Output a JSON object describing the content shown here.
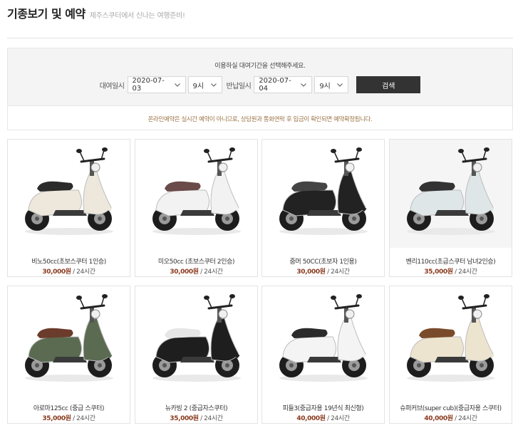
{
  "header": {
    "title": "기종보기 및 예약",
    "subtitle": "제주스쿠터에서 신나는 여행준비!"
  },
  "search": {
    "guide": "이용하실 대여기간을 선택해주세요.",
    "rent_label": "대여일시",
    "rent_date": "2020-07-03",
    "rent_hour": "9시",
    "return_label": "반납일시",
    "return_date": "2020-07-04",
    "return_hour": "9시",
    "search_button": "검색",
    "notice": "온라인예약은 실시간 예약이 아니므로, 상담원과 통화연락 후 입금이 확인되면 예약확정됩니다."
  },
  "products": [
    {
      "name": "비노50cc(초보스쿠터 1인승)",
      "price": "30,000원",
      "unit": " / 24시간",
      "body": "#ede7dc",
      "accent": "#2b2b2b"
    },
    {
      "name": "미오50cc (초보스쿠터 2인승)",
      "price": "30,000원",
      "unit": " / 24시간",
      "body": "#f2f2f2",
      "accent": "#6b4a4a"
    },
    {
      "name": "줌머 50CC(초보자 1인용)",
      "price": "30,000원",
      "unit": " / 24시간",
      "body": "#222222",
      "accent": "#444444"
    },
    {
      "name": "벤리110cc(초급스쿠터 남녀2인승)",
      "price": "35,000원",
      "unit": " / 24시간",
      "body": "#dfe6e8",
      "accent": "#333333"
    },
    {
      "name": "아로마125cc (중급 스쿠터)",
      "price": "35,000원",
      "unit": " / 24시간",
      "body": "#5b6b52",
      "accent": "#6b3b2b"
    },
    {
      "name": "뉴카빙 2 (중급자스쿠터)",
      "price": "35,000원",
      "unit": " / 24시간",
      "body": "#1e1e1e",
      "accent": "#e6e6e6"
    },
    {
      "name": "피들3(중급자용 19년식 최신형)",
      "price": "40,000원",
      "unit": " / 24시간",
      "body": "#f4f4f4",
      "accent": "#2b2b2b"
    },
    {
      "name": "슈퍼커브(super cub)(중급자용 스쿠터)",
      "price": "40,000원",
      "unit": " / 24시간",
      "body": "#ece4cf",
      "accent": "#7a4b2a"
    }
  ]
}
